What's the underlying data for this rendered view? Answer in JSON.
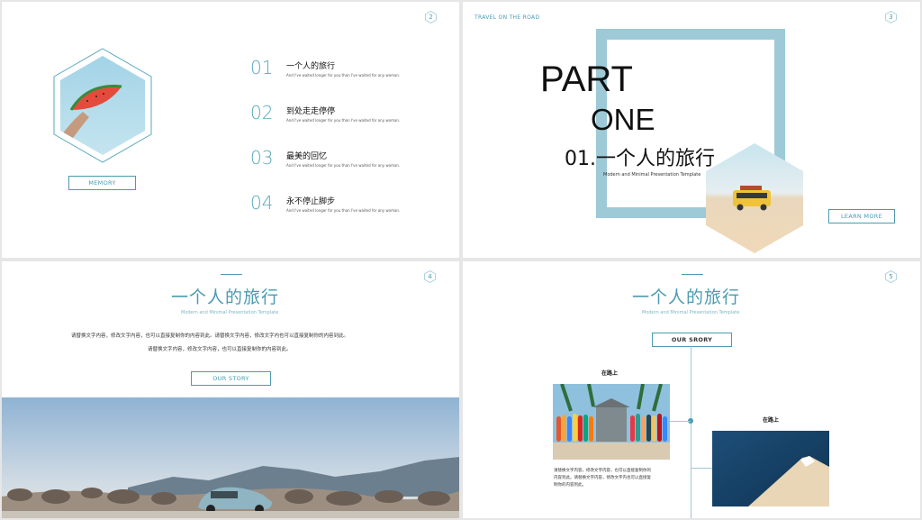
{
  "slide2": {
    "page_number": "2",
    "memory_label": "MEMORY",
    "items": [
      {
        "num": "01",
        "title": "一个人的旅行",
        "desc": "And I've waited longer for you than I've waited for any woman."
      },
      {
        "num": "02",
        "title": "到处走走停停",
        "desc": "And I've waited longer for you than I've waited for any woman."
      },
      {
        "num": "03",
        "title": "最美的回忆",
        "desc": "And I've waited longer for you than I've waited for any woman."
      },
      {
        "num": "04",
        "title": "永不停止脚步",
        "desc": "And I've waited longer for you than I've waited for any woman."
      }
    ]
  },
  "slide3": {
    "header": "TRAVEL ON THE ROAD",
    "page_number": "3",
    "part": "PART",
    "one": "ONE",
    "title": "01.一个人的旅行",
    "subtitle": "Modern and Minimal Presentation Template",
    "learn_more": "LEARN MORE"
  },
  "slide4": {
    "page_number": "4",
    "title": "一个人的旅行",
    "subtitle": "Modern and Minimal Presentation Template",
    "body_line1": "请替换文字内容，修改文字内容，也可以直接复制你的内容到此。请替换文字内容，修改文字内也可以直接复制你的内容到此。",
    "body_line2": "请替换文字内容，修改文字内容，也可以直接复制你的内容到此。",
    "button": "OUR STORY"
  },
  "slide5": {
    "page_number": "5",
    "title": "一个人的旅行",
    "subtitle": "Modern and Minimal Presentation Template",
    "button": "OUR SRORY",
    "left_caption": "在路上",
    "right_caption": "在路上",
    "left_text": [
      "请替换文字内容，修改文字内容，也可以直接复制你的",
      "内容到此。请替换文字内容，修改文字内也可以直接复",
      "制你的内容到此。"
    ]
  },
  "colors": {
    "accent": "#4a9bb0",
    "frame": "#9dcad6"
  }
}
